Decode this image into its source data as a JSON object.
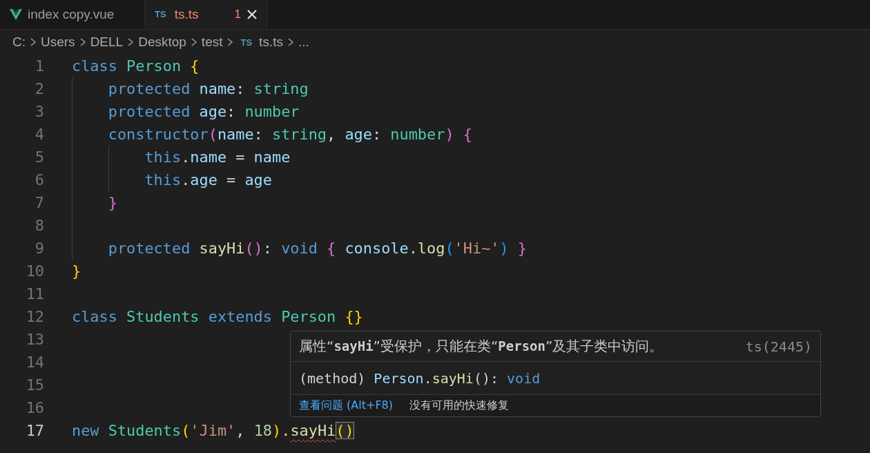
{
  "tabs": [
    {
      "label": "index copy.vue",
      "selected": false,
      "has_errors": false
    },
    {
      "label": "ts.ts",
      "icon_text": "TS",
      "selected": true,
      "has_errors": true,
      "error_count": "1"
    }
  ],
  "breadcrumbs": [
    {
      "label": "C:"
    },
    {
      "label": "Users"
    },
    {
      "label": "DELL"
    },
    {
      "label": "Desktop"
    },
    {
      "label": "test"
    },
    {
      "label": "ts.ts",
      "icon_text": "TS"
    },
    {
      "label": "..."
    }
  ],
  "code": {
    "lines": [
      {
        "number": "1",
        "current": false,
        "tokens": [
          {
            "text": "class",
            "kind": "kw"
          },
          {
            "text": " Person",
            "kind": "type"
          },
          {
            "text": " {",
            "kind": "b1"
          }
        ]
      },
      {
        "number": "2",
        "current": false,
        "tokens": [
          {
            "text": "    protected",
            "kind": "kw"
          },
          {
            "text": " name",
            "kind": "var"
          },
          {
            "text": ":",
            "kind": "plain"
          },
          {
            "text": " string",
            "kind": "type"
          }
        ]
      },
      {
        "number": "3",
        "current": false,
        "tokens": [
          {
            "text": "    protected",
            "kind": "kw"
          },
          {
            "text": " age",
            "kind": "var"
          },
          {
            "text": ":",
            "kind": "plain"
          },
          {
            "text": " number",
            "kind": "type"
          }
        ]
      },
      {
        "number": "4",
        "current": false,
        "tokens": [
          {
            "text": "    constructor",
            "kind": "kw"
          },
          {
            "text": "(",
            "kind": "b2"
          },
          {
            "text": "name",
            "kind": "var"
          },
          {
            "text": ":",
            "kind": "plain"
          },
          {
            "text": " string",
            "kind": "type"
          },
          {
            "text": ",",
            "kind": "plain"
          },
          {
            "text": " age",
            "kind": "var"
          },
          {
            "text": ":",
            "kind": "plain"
          },
          {
            "text": " number",
            "kind": "type"
          },
          {
            "text": ")",
            "kind": "b2"
          },
          {
            "text": " {",
            "kind": "b2"
          }
        ]
      },
      {
        "number": "5",
        "current": false,
        "tokens": [
          {
            "text": "        this",
            "kind": "kw"
          },
          {
            "text": ".",
            "kind": "plain"
          },
          {
            "text": "name",
            "kind": "var"
          },
          {
            "text": " =",
            "kind": "plain"
          },
          {
            "text": " name",
            "kind": "var"
          }
        ]
      },
      {
        "number": "6",
        "current": false,
        "tokens": [
          {
            "text": "        this",
            "kind": "kw"
          },
          {
            "text": ".",
            "kind": "plain"
          },
          {
            "text": "age",
            "kind": "var"
          },
          {
            "text": " =",
            "kind": "plain"
          },
          {
            "text": " age",
            "kind": "var"
          }
        ]
      },
      {
        "number": "7",
        "current": false,
        "tokens": [
          {
            "text": "    }",
            "kind": "b2"
          }
        ]
      },
      {
        "number": "8",
        "current": false
      },
      {
        "number": "9",
        "current": false,
        "tokens": [
          {
            "text": "    protected",
            "kind": "kw"
          },
          {
            "text": " sayHi",
            "kind": "fn"
          },
          {
            "text": "()",
            "kind": "b2"
          },
          {
            "text": ":",
            "kind": "plain"
          },
          {
            "text": " void",
            "kind": "kw"
          },
          {
            "text": " {",
            "kind": "b2"
          },
          {
            "text": " console",
            "kind": "var"
          },
          {
            "text": ".",
            "kind": "plain"
          },
          {
            "text": "log",
            "kind": "fn"
          },
          {
            "text": "(",
            "kind": "b3"
          },
          {
            "text": "'Hi~'",
            "kind": "str"
          },
          {
            "text": ")",
            "kind": "b3"
          },
          {
            "text": " }",
            "kind": "b2"
          }
        ]
      },
      {
        "number": "10",
        "current": false,
        "tokens": [
          {
            "text": "}",
            "kind": "b1"
          }
        ]
      },
      {
        "number": "11",
        "current": false
      },
      {
        "number": "12",
        "current": false,
        "tokens": [
          {
            "text": "class",
            "kind": "kw"
          },
          {
            "text": " Students",
            "kind": "type"
          },
          {
            "text": " extends",
            "kind": "kw"
          },
          {
            "text": " Person",
            "kind": "type"
          },
          {
            "text": " {}",
            "kind": "b1"
          }
        ]
      },
      {
        "number": "13",
        "current": false
      },
      {
        "number": "14",
        "current": false
      },
      {
        "number": "15",
        "current": false
      },
      {
        "number": "16",
        "current": false
      },
      {
        "number": "17",
        "current": true,
        "tokens": [
          {
            "text": "new",
            "kind": "kw"
          },
          {
            "text": " Students",
            "kind": "type"
          },
          {
            "text": "(",
            "kind": "b1"
          },
          {
            "text": "'Jim'",
            "kind": "str"
          },
          {
            "text": ",",
            "kind": "plain"
          },
          {
            "text": " 18",
            "kind": "num"
          },
          {
            "text": ")",
            "kind": "b1"
          },
          {
            "text": ".",
            "kind": "plain"
          },
          {
            "text": "sayHi",
            "kind": "fn",
            "error": true
          },
          {
            "text": "()",
            "kind": "b1",
            "matched": true
          }
        ]
      }
    ]
  },
  "hover": {
    "message": [
      {
        "text": "属性“",
        "kind": "text"
      },
      {
        "text": "sayHi",
        "kind": "code"
      },
      {
        "text": "”受保护，只能在类“",
        "kind": "text"
      },
      {
        "text": "Person",
        "kind": "code"
      },
      {
        "text": "”及其子类中访问。",
        "kind": "text"
      }
    ],
    "source": "ts(2445)",
    "signature": [
      {
        "text": "(method)",
        "kind": "plain"
      },
      {
        "text": " Person",
        "kind": "var"
      },
      {
        "text": ".",
        "kind": "plain"
      },
      {
        "text": "sayHi",
        "kind": "fn"
      },
      {
        "text": "():",
        "kind": "plain"
      },
      {
        "text": " void",
        "kind": "kw"
      }
    ],
    "view_problem": "查看问题 (Alt+F8)",
    "quick_fix": "没有可用的快速修复"
  }
}
